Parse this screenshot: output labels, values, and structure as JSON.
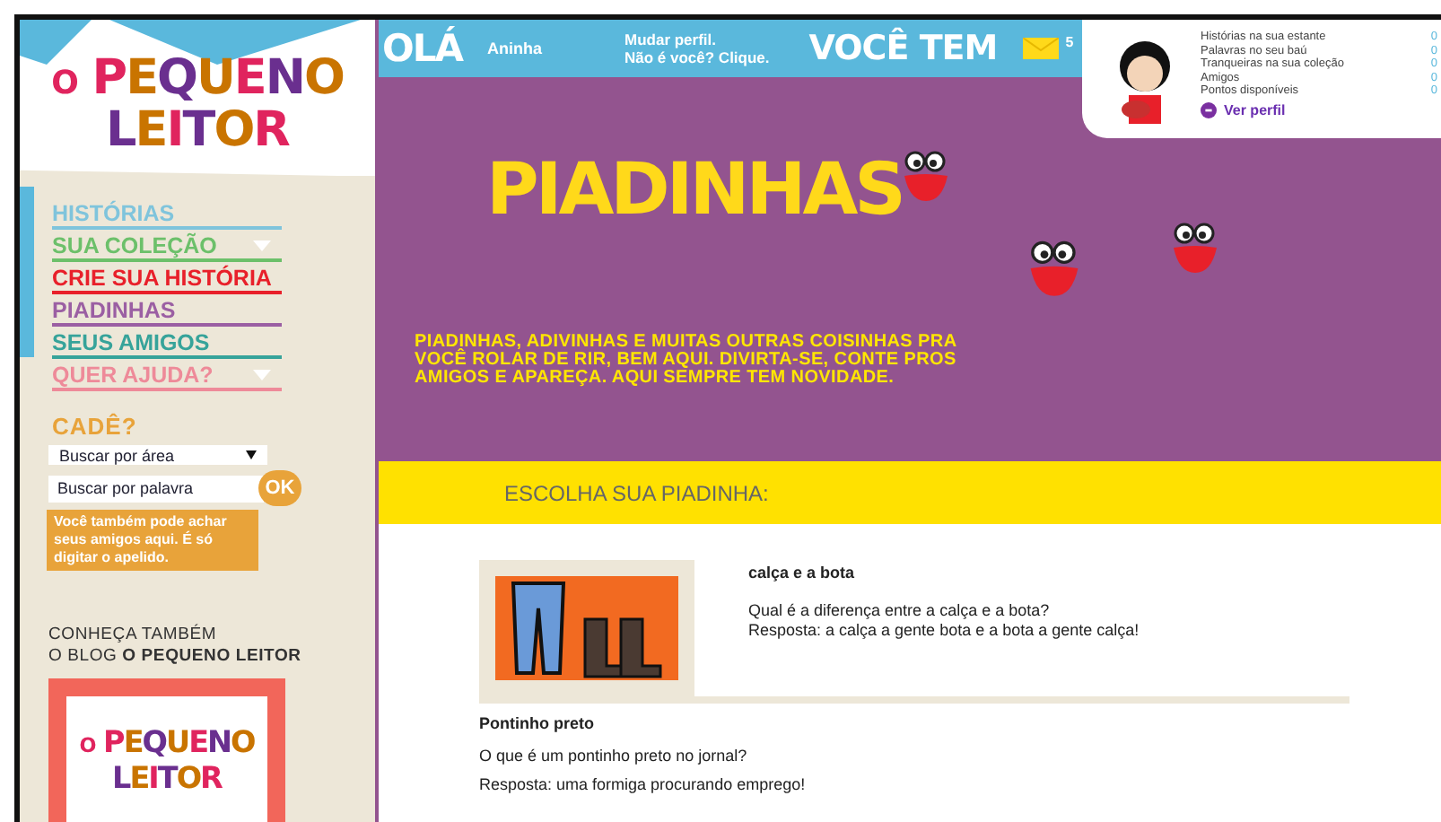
{
  "sidebar": {
    "logo": {
      "top": "O",
      "word1": "PEQUENO",
      "word2": "LEITOR"
    },
    "nav": [
      {
        "label": "HISTÓRIAS",
        "color": "#7fc4dc",
        "has_menu": false
      },
      {
        "label": "SUA COLEÇÃO",
        "color": "#6cc06a",
        "has_menu": true
      },
      {
        "label": "CRIE SUA HISTÓRIA",
        "color": "#e8202a",
        "has_menu": false
      },
      {
        "label": "PIADINHAS",
        "color": "#9b5fa3",
        "has_menu": false
      },
      {
        "label": "SEUS AMIGOS",
        "color": "#36a39a",
        "has_menu": false
      },
      {
        "label": "QUER AJUDA?",
        "color": "#ee8a99",
        "has_menu": true
      }
    ],
    "search": {
      "title": "CADÊ?",
      "area_select": "Buscar por área",
      "word_field": {
        "placeholder": "Buscar por palavra"
      },
      "ok": "OK",
      "tip": "Você também pode achar seus amigos aqui. É só digitar o apelido."
    },
    "blog": {
      "line1": "CONHEÇA TAMBÉM",
      "line2": "O BLOG **O PEQUENO LEITOR**",
      "logo": {
        "top": "O",
        "word1": "PEQUENO",
        "word2": "LEITOR"
      }
    }
  },
  "header": {
    "greeting": "OLÁ",
    "user": "Aninha",
    "change_profile": "Mudar perfil.",
    "not_you": "Não é você? Clique.",
    "you_have": "VOCÊ TEM",
    "messages": "5"
  },
  "profile": {
    "stats": [
      {
        "label": "Histórias na sua estante",
        "value": "0"
      },
      {
        "label": "Palavras no seu baú",
        "value": "0"
      },
      {
        "label": "Tranqueiras na sua coleção",
        "value": "0"
      },
      {
        "label": "Amigos",
        "value": "0"
      },
      {
        "label": "Pontos disponíveis",
        "value": "0"
      }
    ],
    "link": "Ver perfil"
  },
  "banner": {
    "title": "PIADINHAS",
    "text": "PIADINHAS, ADIVINHAS E MUITAS OUTRAS COISINHAS PRA VOCÊ ROLAR DE RIR, BEM AQUI. DIVIRTA-SE, CONTE PROS AMIGOS E APAREÇA. AQUI SEMPRE TEM NOVIDADE."
  },
  "section_title": "ESCOLHA SUA PIADINHA:",
  "jokes": [
    {
      "title": "calça e a bota",
      "question": "Qual é a diferença entre a calça e a bota?",
      "answer": "Resposta: a calça a gente bota e a bota a gente calça!",
      "has_image": true
    },
    {
      "title": "Pontinho preto",
      "question": "O que é um pontinho preto no jornal?",
      "answer": "Resposta: uma formiga procurando emprego!",
      "has_image": false
    }
  ]
}
